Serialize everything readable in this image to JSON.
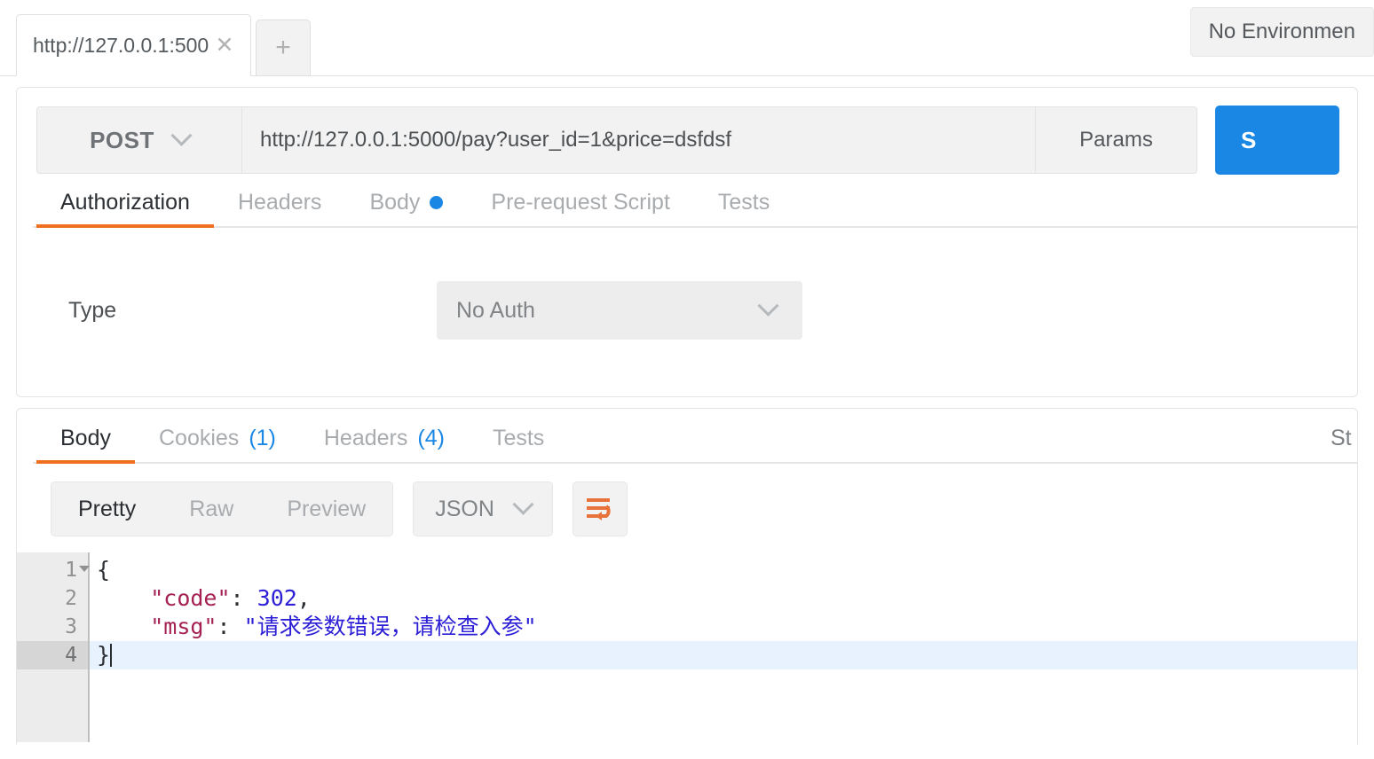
{
  "app": {
    "tabstrip": {
      "request_tab_label": "http://127.0.0.1:500",
      "close_icon": "close-icon",
      "new_tab_label": "+",
      "environment_label": "No Environmen"
    }
  },
  "request": {
    "method": "POST",
    "url": "http://127.0.0.1:5000/pay?user_id=1&price=dsfdsf",
    "params_label": "Params",
    "send_label": "S",
    "tabs": [
      {
        "label": "Authorization",
        "active": true,
        "dot": false
      },
      {
        "label": "Headers",
        "active": false,
        "dot": false
      },
      {
        "label": "Body",
        "active": false,
        "dot": true
      },
      {
        "label": "Pre-request Script",
        "active": false,
        "dot": false
      },
      {
        "label": "Tests",
        "active": false,
        "dot": false
      }
    ],
    "auth": {
      "type_label": "Type",
      "type_value": "No Auth"
    }
  },
  "response": {
    "tabs": [
      {
        "label": "Body",
        "count": "",
        "active": true
      },
      {
        "label": "Cookies",
        "count": "(1)",
        "active": false
      },
      {
        "label": "Headers",
        "count": "(4)",
        "active": false
      },
      {
        "label": "Tests",
        "count": "",
        "active": false
      }
    ],
    "status_text": "St",
    "view_modes": [
      {
        "label": "Pretty",
        "active": true
      },
      {
        "label": "Raw",
        "active": false
      },
      {
        "label": "Preview",
        "active": false
      }
    ],
    "format": "JSON",
    "wrap_icon": "word-wrap-icon",
    "body": {
      "lines": [
        {
          "number": "1",
          "foldable": true,
          "active": false,
          "segments": [
            {
              "text": "{",
              "type": "punc"
            }
          ]
        },
        {
          "number": "2",
          "foldable": false,
          "active": false,
          "segments": [
            {
              "text": "    ",
              "type": "punc"
            },
            {
              "text": "\"code\"",
              "type": "key"
            },
            {
              "text": ": ",
              "type": "punc"
            },
            {
              "text": "302",
              "type": "num"
            },
            {
              "text": ",",
              "type": "punc"
            }
          ]
        },
        {
          "number": "3",
          "foldable": false,
          "active": false,
          "segments": [
            {
              "text": "    ",
              "type": "punc"
            },
            {
              "text": "\"msg\"",
              "type": "key"
            },
            {
              "text": ": ",
              "type": "punc"
            },
            {
              "text": "\"请求参数错误，请检查入参\"",
              "type": "str"
            }
          ]
        },
        {
          "number": "4",
          "foldable": false,
          "active": true,
          "segments": [
            {
              "text": "}",
              "type": "punc"
            }
          ]
        }
      ]
    }
  },
  "colors": {
    "accent_orange": "#f1701f",
    "accent_blue": "#1a87e5",
    "json_key": "#a52153",
    "json_value": "#2c1fd6",
    "active_line": "#e8f2fe"
  }
}
